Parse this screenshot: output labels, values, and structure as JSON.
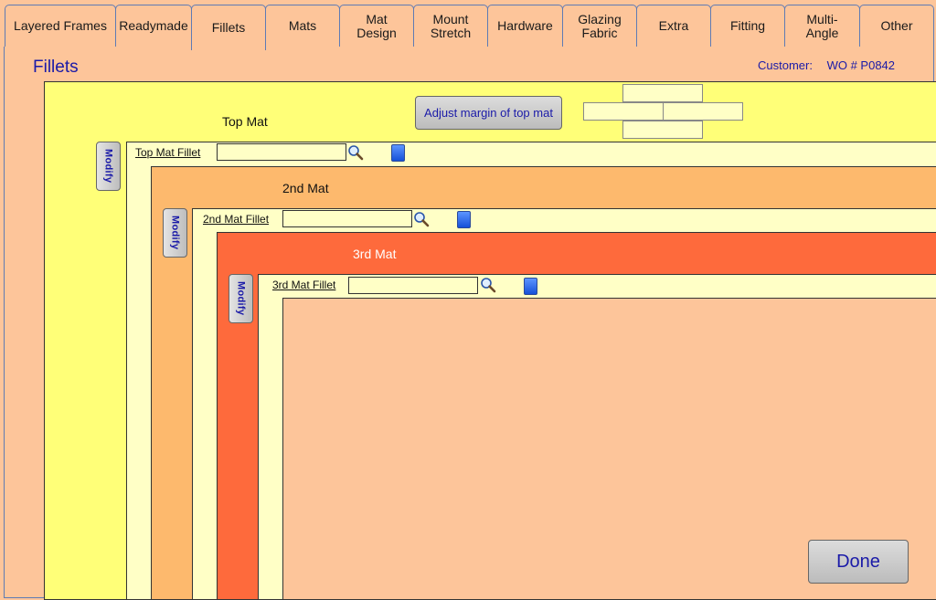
{
  "tabs": [
    {
      "label": "Layered Frames"
    },
    {
      "label": "Readymade"
    },
    {
      "label": "Fillets",
      "active": true
    },
    {
      "label": "Mats"
    },
    {
      "label": "Mat\nDesign"
    },
    {
      "label": "Mount\nStretch"
    },
    {
      "label": "Hardware"
    },
    {
      "label": "Glazing\nFabric"
    },
    {
      "label": "Extra"
    },
    {
      "label": "Fitting"
    },
    {
      "label": "Multi-\nAngle"
    },
    {
      "label": "Other"
    }
  ],
  "page": {
    "title": "Fillets",
    "customer_label": "Customer:",
    "wo_label": "WO # P0842"
  },
  "mats": [
    {
      "label": "Top Mat",
      "fillet_label": "Top Mat Fillet",
      "fillet_value": "",
      "color": "#ffff78"
    },
    {
      "label": "2nd Mat",
      "fillet_label": "2nd Mat Fillet",
      "fillet_value": "",
      "color": "#fdb96d"
    },
    {
      "label": "3rd Mat",
      "fillet_label": "3rd Mat Fillet",
      "fillet_value": "",
      "color": "#fe6a3c"
    }
  ],
  "modify_label": "Modify",
  "adjust_margin_label": "Adjust margin of top mat",
  "margins": {
    "top": "",
    "left": "",
    "right": "",
    "bottom": ""
  },
  "done_label": "Done",
  "colors": {
    "background": "#fdc59a",
    "fillet": "#ffffc6",
    "accent_text": "#1a1aa8",
    "swatch": "#2f6cf0"
  }
}
